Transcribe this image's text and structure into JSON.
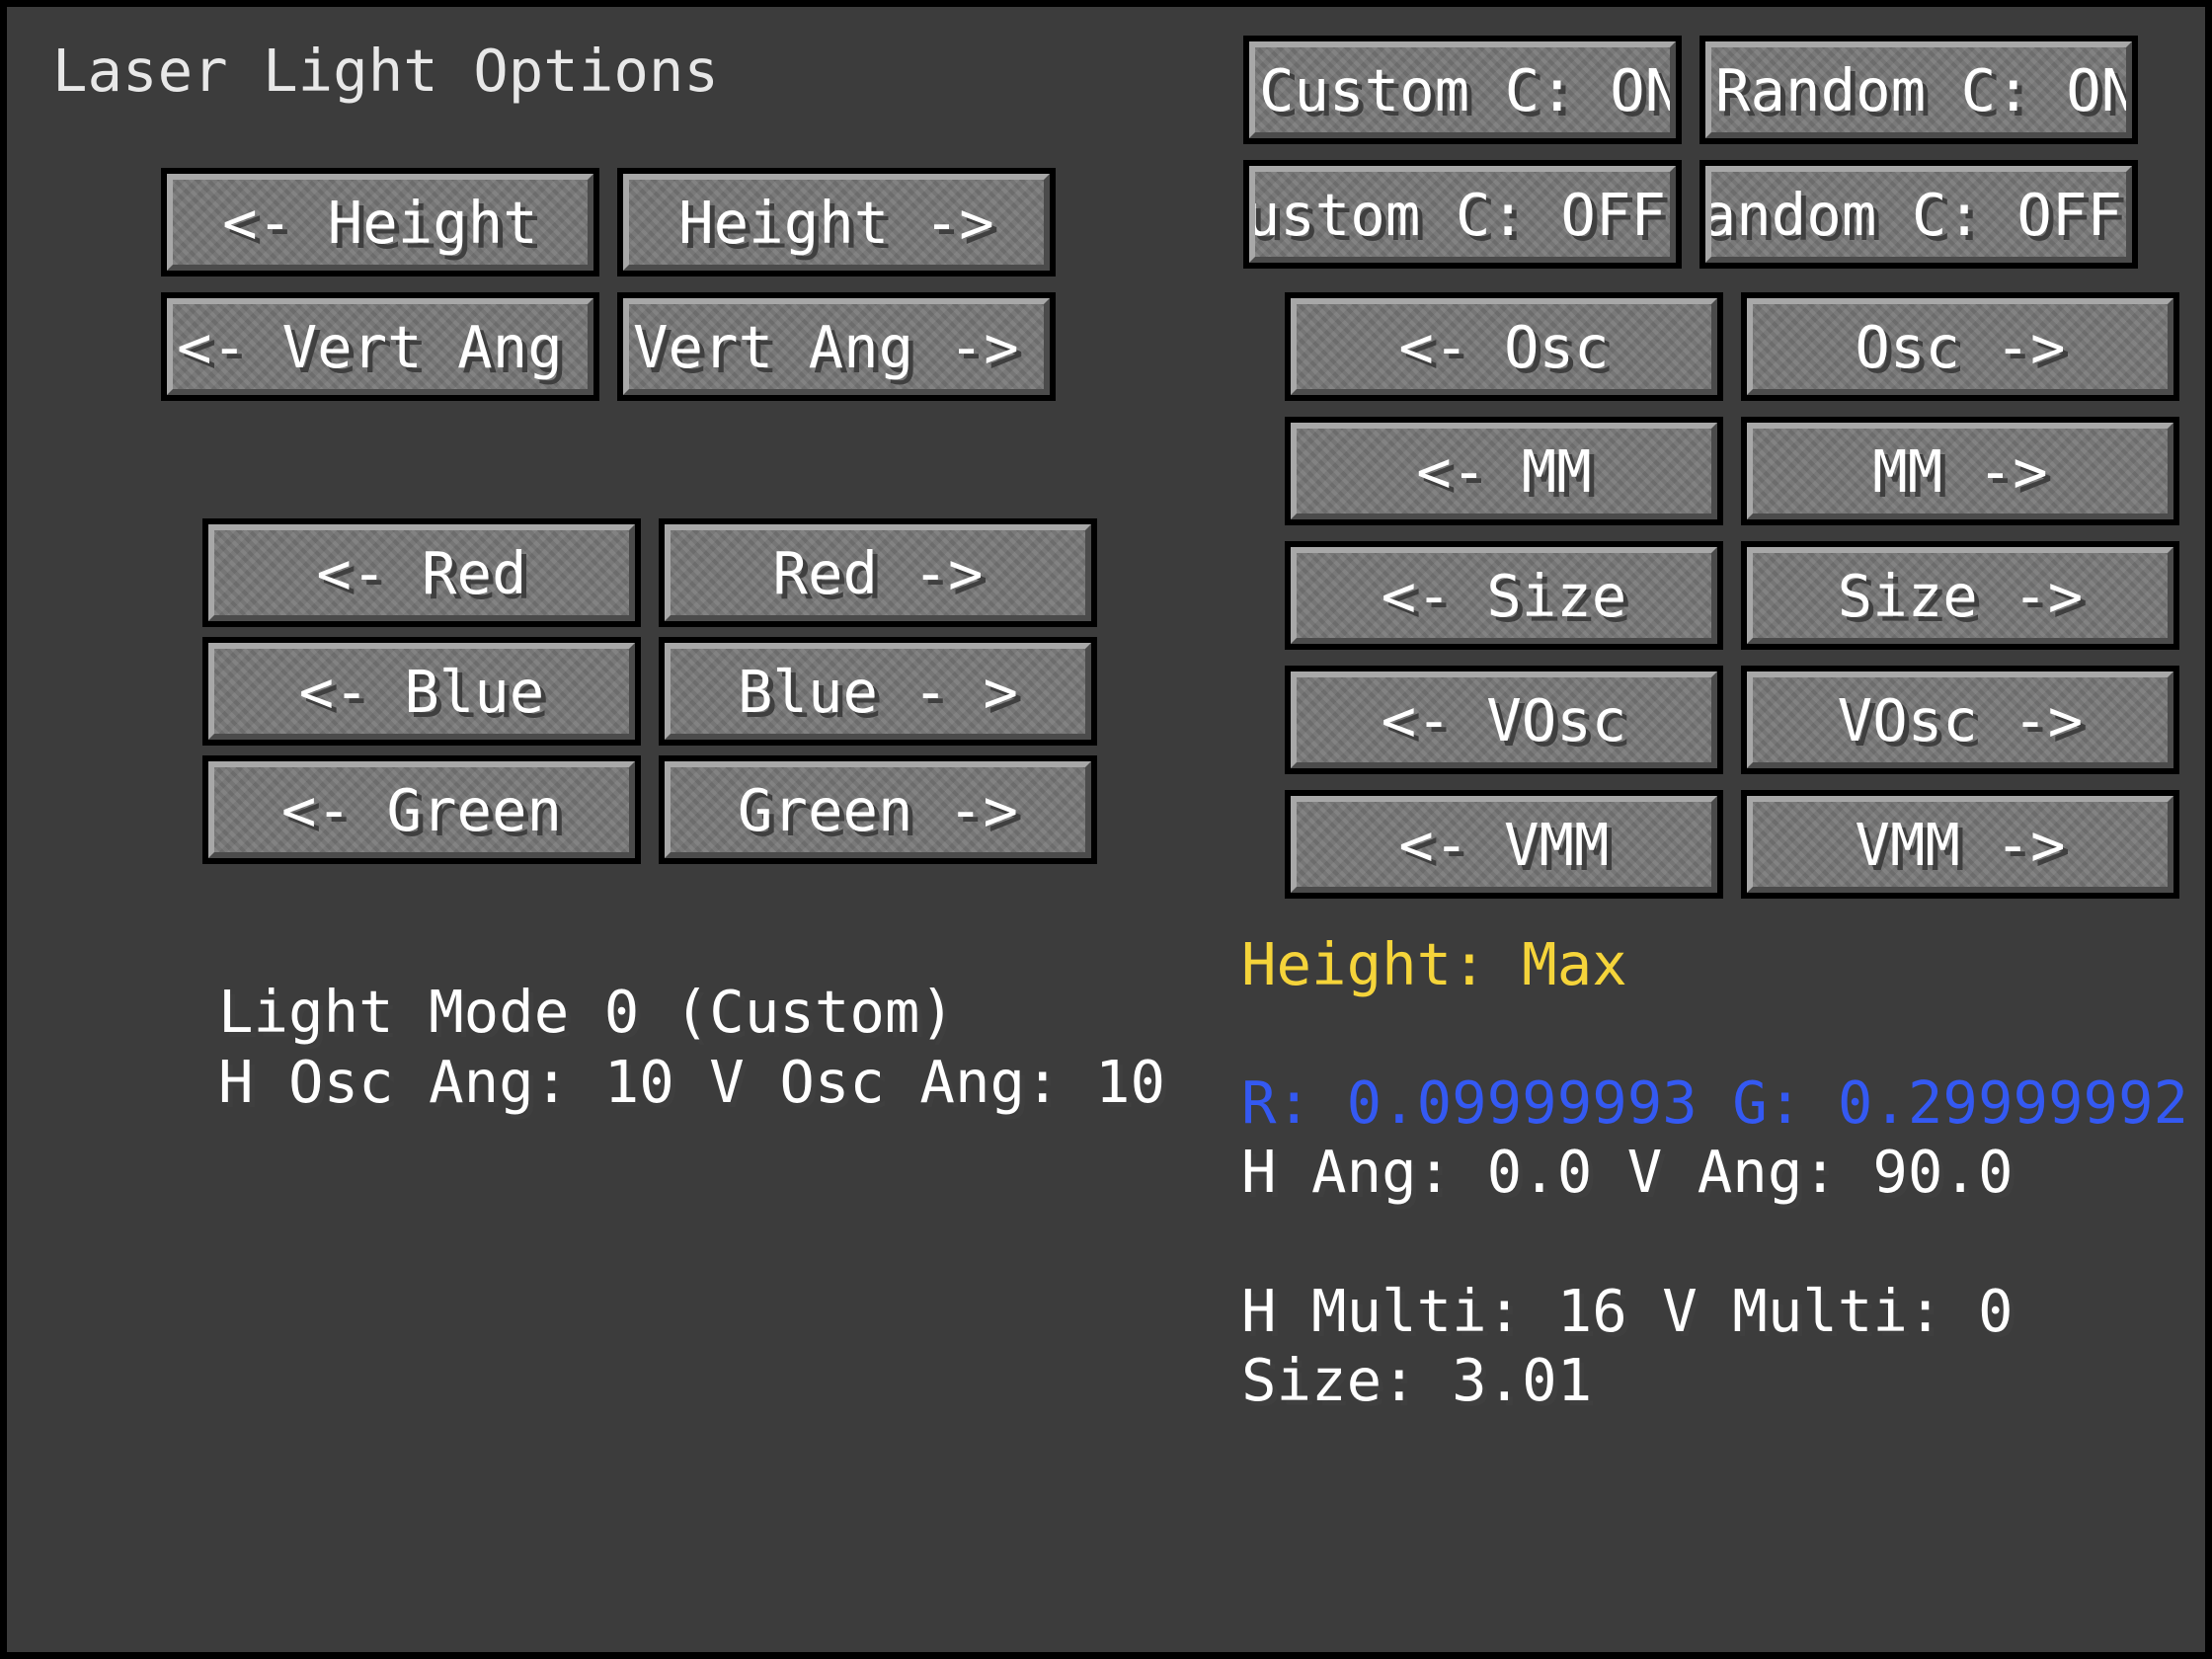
{
  "title": "Laser Light Options",
  "left_buttons": {
    "height_dec": "<- Height",
    "height_inc": "Height ->",
    "vert_ang_dec": "<- Vert Ang",
    "vert_ang_inc": "Vert Ang ->",
    "red_dec": "<- Red",
    "red_inc": "Red ->",
    "blue_dec": "<- Blue",
    "blue_inc": "Blue - >",
    "green_dec": "<- Green",
    "green_inc": "Green ->"
  },
  "toggle_buttons": {
    "custom_c_1": "Custom C: ON",
    "random_c_1": "Random C: ON",
    "custom_c_2": "Custom C: OFF",
    "random_c_2": "Random C: OFF"
  },
  "right_buttons": {
    "osc_dec": "<- Osc",
    "osc_inc": "Osc ->",
    "mm_dec": "<- MM",
    "mm_inc": "MM ->",
    "size_dec": "<- Size",
    "size_inc": "Size ->",
    "vosc_dec": "<- VOsc",
    "vosc_inc": "VOsc ->",
    "vmm_dec": "<- VMM",
    "vmm_inc": "VMM ->"
  },
  "status": {
    "light_mode": "Light Mode 0 (Custom)",
    "osc_angles": "H Osc Ang: 10 V Osc Ang: 10",
    "height": "Height: Max",
    "rgb": "R: 0.09999993 G: 0.29999992",
    "angles": "H Ang: 0.0 V Ang: 90.0",
    "multi": "H Multi: 16 V Multi: 0",
    "size": "Size: 3.01"
  },
  "colors": {
    "background": "#3c3c3c",
    "height_text": "#f5d43a",
    "rgb_text": "#3459f2"
  }
}
